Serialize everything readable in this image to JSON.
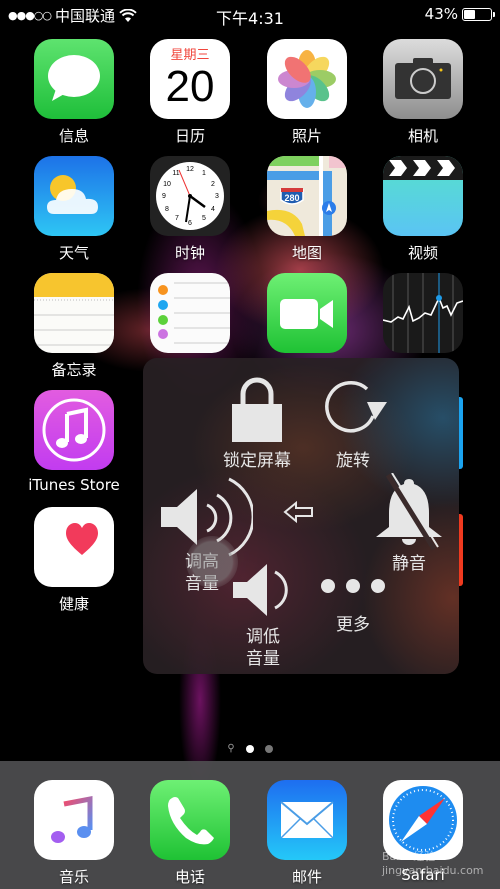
{
  "status_bar": {
    "signal": "●●●○○",
    "carrier": "中国联通",
    "time": "下午4:31",
    "battery_percent": "43%",
    "battery_level": 0.43
  },
  "home_apps": [
    {
      "label": "信息",
      "icon": "messages-icon"
    },
    {
      "label": "日历",
      "icon": "calendar-icon",
      "weekday": "星期三",
      "day": "20"
    },
    {
      "label": "照片",
      "icon": "photos-icon"
    },
    {
      "label": "相机",
      "icon": "camera-icon"
    },
    {
      "label": "天气",
      "icon": "weather-icon"
    },
    {
      "label": "时钟",
      "icon": "clock-icon"
    },
    {
      "label": "地图",
      "icon": "maps-icon",
      "sign": "280"
    },
    {
      "label": "视频",
      "icon": "videos-icon"
    },
    {
      "label": "备忘录",
      "icon": "notes-icon"
    },
    {
      "label": "",
      "icon": "reminders-icon"
    },
    {
      "label": "",
      "icon": "facetime-icon"
    },
    {
      "label": "",
      "icon": "stocks-icon"
    },
    {
      "label": "iTunes Store",
      "icon": "itunes-store-icon"
    },
    {
      "label": "健康",
      "icon": "health-icon"
    }
  ],
  "page_indicator": {
    "search": "⚲",
    "pages": 2,
    "current": 1
  },
  "dock": [
    {
      "label": "音乐",
      "icon": "music-icon"
    },
    {
      "label": "电话",
      "icon": "phone-icon"
    },
    {
      "label": "邮件",
      "icon": "mail-icon"
    },
    {
      "label": "Safari",
      "icon": "safari-icon"
    }
  ],
  "assistive_touch": {
    "lock_screen": "锁定屏幕",
    "rotate": "旋转",
    "volume_up": "调高\n音量",
    "volume_up_l1": "调高",
    "volume_up_l2": "音量",
    "mute": "静音",
    "volume_down_l1": "调低",
    "volume_down_l2": "音量",
    "more": "更多",
    "back": "⇦"
  },
  "watermark": "Baidu经验 jingyan.baidu.com"
}
